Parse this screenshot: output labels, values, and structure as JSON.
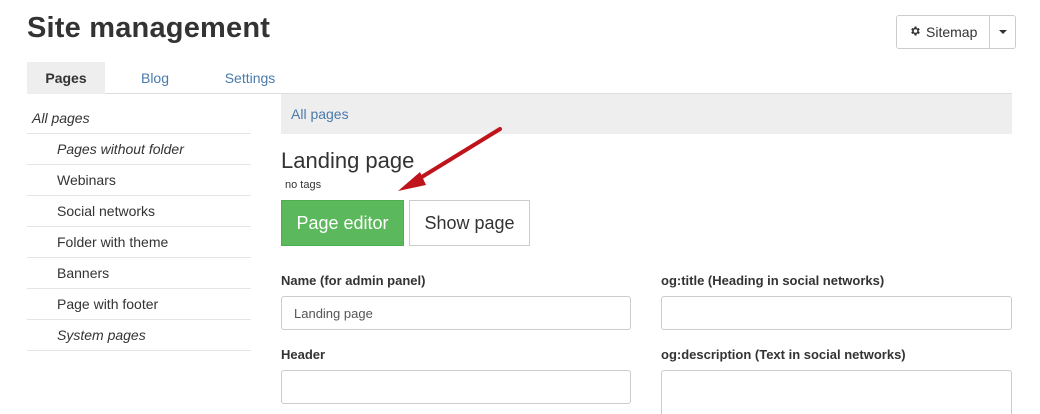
{
  "header": {
    "title": "Site management",
    "sitemap_label": "Sitemap"
  },
  "tabs": [
    {
      "label": "Pages",
      "active": true
    },
    {
      "label": "Blog",
      "active": false
    },
    {
      "label": "Settings",
      "active": false
    }
  ],
  "sidebar": {
    "items": [
      {
        "label": "All pages"
      },
      {
        "label": "Pages without folder"
      },
      {
        "label": "Webinars"
      },
      {
        "label": "Social networks"
      },
      {
        "label": "Folder with theme"
      },
      {
        "label": "Banners"
      },
      {
        "label": "Page with footer"
      },
      {
        "label": "System pages"
      }
    ]
  },
  "breadcrumb": "All pages",
  "page": {
    "title": "Landing page",
    "tags": "no tags",
    "editor_button": "Page editor",
    "show_button": "Show page"
  },
  "form": {
    "name_label": "Name (for admin panel)",
    "name_value": "Landing page",
    "og_title_label": "og:title (Heading in social networks)",
    "og_title_value": "",
    "header_label": "Header",
    "header_value": "",
    "og_description_label": "og:description (Text in social networks)",
    "og_description_value": ""
  },
  "colors": {
    "accent_green": "#5cb85c",
    "link_blue": "#4a7aab",
    "annotation_red": "#c0141c"
  }
}
